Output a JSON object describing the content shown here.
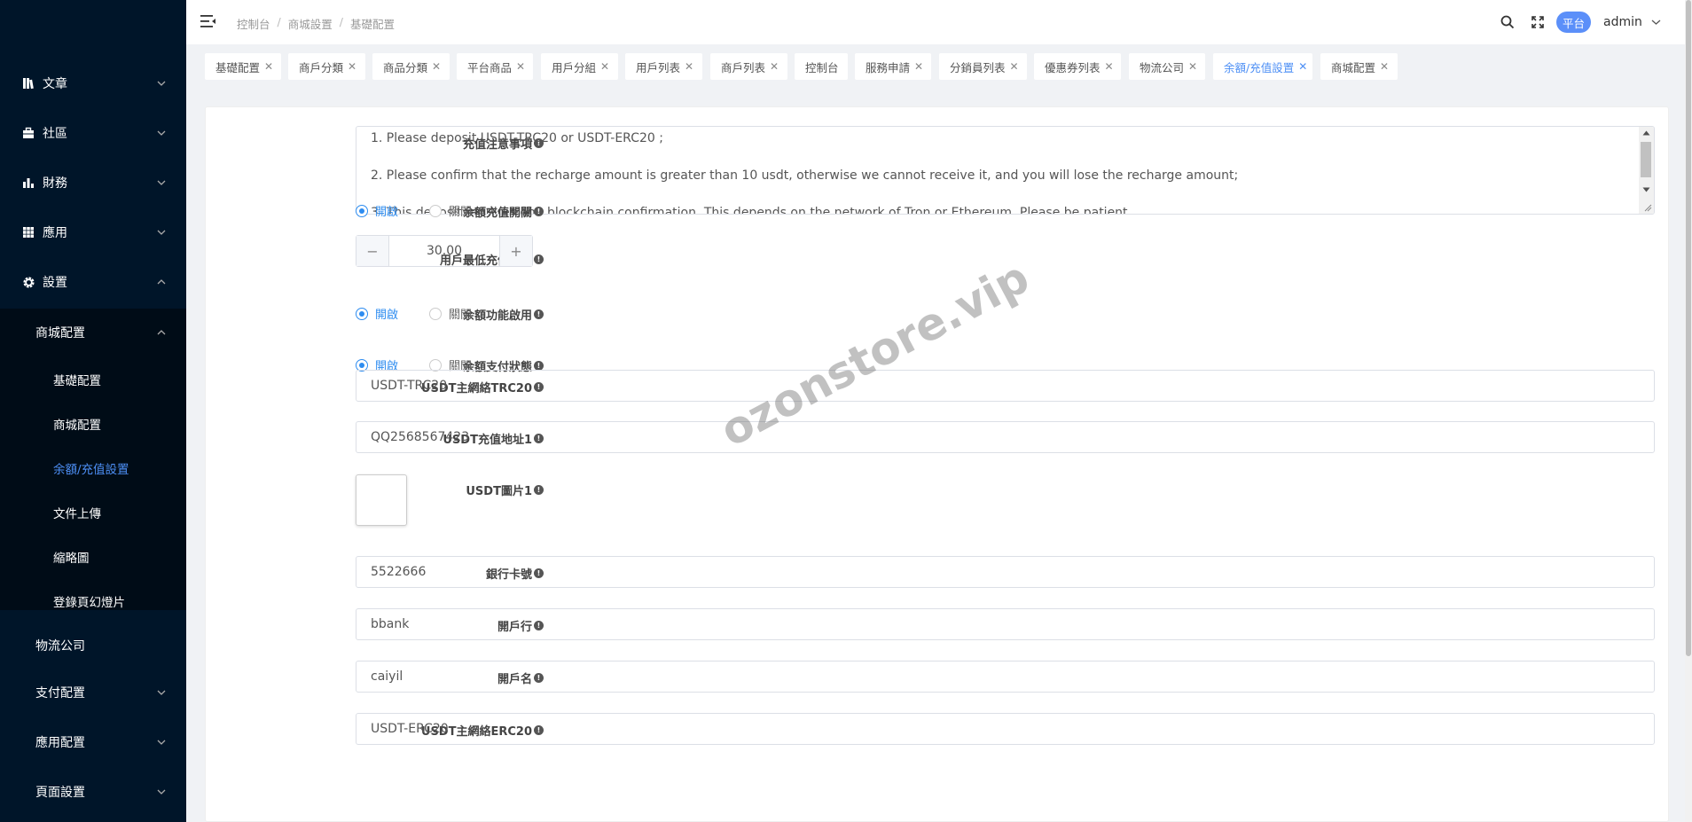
{
  "sidebar": {
    "items": [
      {
        "label": "文章",
        "icon": "document-icon"
      },
      {
        "label": "社區",
        "icon": "briefcase-icon"
      },
      {
        "label": "財務",
        "icon": "bar-chart-icon"
      },
      {
        "label": "應用",
        "icon": "grid-icon"
      },
      {
        "label": "設置",
        "icon": "gear-icon"
      }
    ],
    "submenu_title": "商城配置",
    "submenu_items": [
      "基礎配置",
      "商城配置",
      "余額/充值設置",
      "文件上傳",
      "縮略圖",
      "登錄頁幻燈片"
    ],
    "lower_items": [
      "物流公司",
      "支付配置",
      "應用配置",
      "頁面設置"
    ],
    "active_color": "#4d8ff5"
  },
  "header": {
    "breadcrumb": [
      "控制台",
      "商城設置",
      "基礎配置"
    ],
    "platform_badge": "平台",
    "user": "admin"
  },
  "tabs": [
    {
      "label": "基礎配置",
      "closable": true
    },
    {
      "label": "商戶分類",
      "closable": true
    },
    {
      "label": "商品分類",
      "closable": true
    },
    {
      "label": "平台商品",
      "closable": true
    },
    {
      "label": "用戶分組",
      "closable": true
    },
    {
      "label": "用戶列表",
      "closable": true
    },
    {
      "label": "商戶列表",
      "closable": true
    },
    {
      "label": "控制台",
      "closable": false
    },
    {
      "label": "服務申請",
      "closable": true
    },
    {
      "label": "分銷員列表",
      "closable": true
    },
    {
      "label": "優惠券列表",
      "closable": true
    },
    {
      "label": "物流公司",
      "closable": true
    },
    {
      "label": "余額/充值設置",
      "closable": true,
      "active": true
    },
    {
      "label": "商城配置",
      "closable": true
    }
  ],
  "form": {
    "notice_label": "充值注意事項",
    "notice_lines": [
      "1. Please deposit USDT-TRC20 or USDT-ERC20 ;",
      "2. Please confirm that the recharge amount is greater than 10 usdt, otherwise we cannot receive it, and you will lose the recharge amount;",
      "3. This deposit requires one blockchain confirmation. This depends on the network of Tron or Ethereum. Please be patient."
    ],
    "recharge_switch_label": "余額充值開關",
    "min_amount_label": "用戶最低充值金額",
    "min_amount_value": "30.00",
    "balance_enable_label": "余額功能啟用",
    "balance_pay_label": "余額支付狀態",
    "radio_on": "開啟",
    "radio_off": "關閉",
    "trc20_label": "USDT主網絡TRC20",
    "trc20_value": "USDT-TRC20",
    "address1_label": "USDT充值地址1",
    "address1_value": "QQ2568567423",
    "image1_label": "USDT圖片1",
    "bank_card_label": "銀行卡號",
    "bank_card_value": "5522666",
    "bank_label": "開戶行",
    "bank_value": "bbank",
    "account_name_label": "開戶名",
    "account_name_value": "caiyil",
    "erc20_label": "USDT主網絡ERC20",
    "erc20_value": "USDT-ERC20"
  },
  "watermark": "ozonstore.vip"
}
